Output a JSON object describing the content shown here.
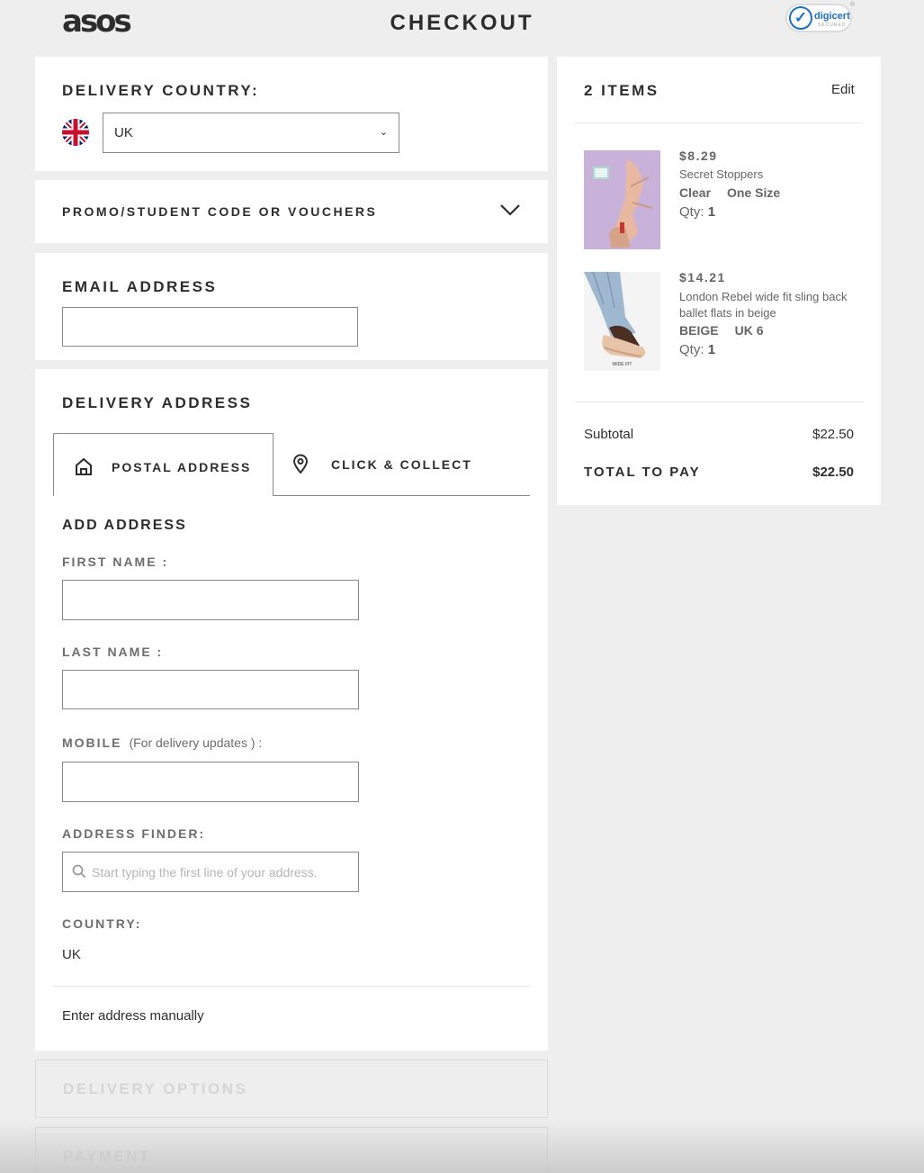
{
  "header": {
    "logo": "asos",
    "title": "CHECKOUT",
    "badge_text": "digicert",
    "badge_sub": "SECURED",
    "badge_reg": "®"
  },
  "delivery_country": {
    "title": "DELIVERY COUNTRY:",
    "selected": "UK",
    "flag": "uk-flag-icon"
  },
  "promo": {
    "title": "PROMO/STUDENT CODE OR VOUCHERS"
  },
  "email": {
    "title": "EMAIL ADDRESS",
    "value": ""
  },
  "delivery_address": {
    "title": "DELIVERY ADDRESS",
    "tabs": [
      {
        "label": "POSTAL ADDRESS",
        "icon": "home-icon",
        "active": true
      },
      {
        "label": "CLICK & COLLECT",
        "icon": "map-pin-icon",
        "active": false
      }
    ],
    "add_address_title": "ADD ADDRESS",
    "first_name_label": "FIRST NAME :",
    "last_name_label": "LAST NAME :",
    "mobile_label": "MOBILE",
    "mobile_note": "(For delivery updates ) :",
    "address_finder_label": "ADDRESS FINDER:",
    "address_finder_placeholder": "Start typing the first line of your address.",
    "country_label": "COUNTRY:",
    "country_value": "UK",
    "manual_link": "Enter address manually"
  },
  "collapsed_sections": {
    "delivery_options": "DELIVERY OPTIONS",
    "payment": "PAYMENT"
  },
  "summary": {
    "items_title": "2 ITEMS",
    "edit_label": "Edit",
    "items": [
      {
        "price": "$8.29",
        "name": "Secret Stoppers",
        "colour": "Clear",
        "size": "One Size",
        "qty_label": "Qty:",
        "qty": "1"
      },
      {
        "price": "$14.21",
        "name": "London Rebel wide fit sling back ballet flats in beige",
        "colour": "BEIGE",
        "size": "UK 6",
        "qty_label": "Qty:",
        "qty": "1",
        "image_caption": "WIDE FIT"
      }
    ],
    "subtotal_label": "Subtotal",
    "subtotal_value": "$22.50",
    "total_label": "TOTAL TO PAY",
    "total_value": "$22.50"
  },
  "colors": {
    "text": "#2d2d2d",
    "muted": "#6d6d6d",
    "background": "#eeeeee",
    "panel": "#ffffff",
    "digicert_blue": "#1a6fc9"
  }
}
